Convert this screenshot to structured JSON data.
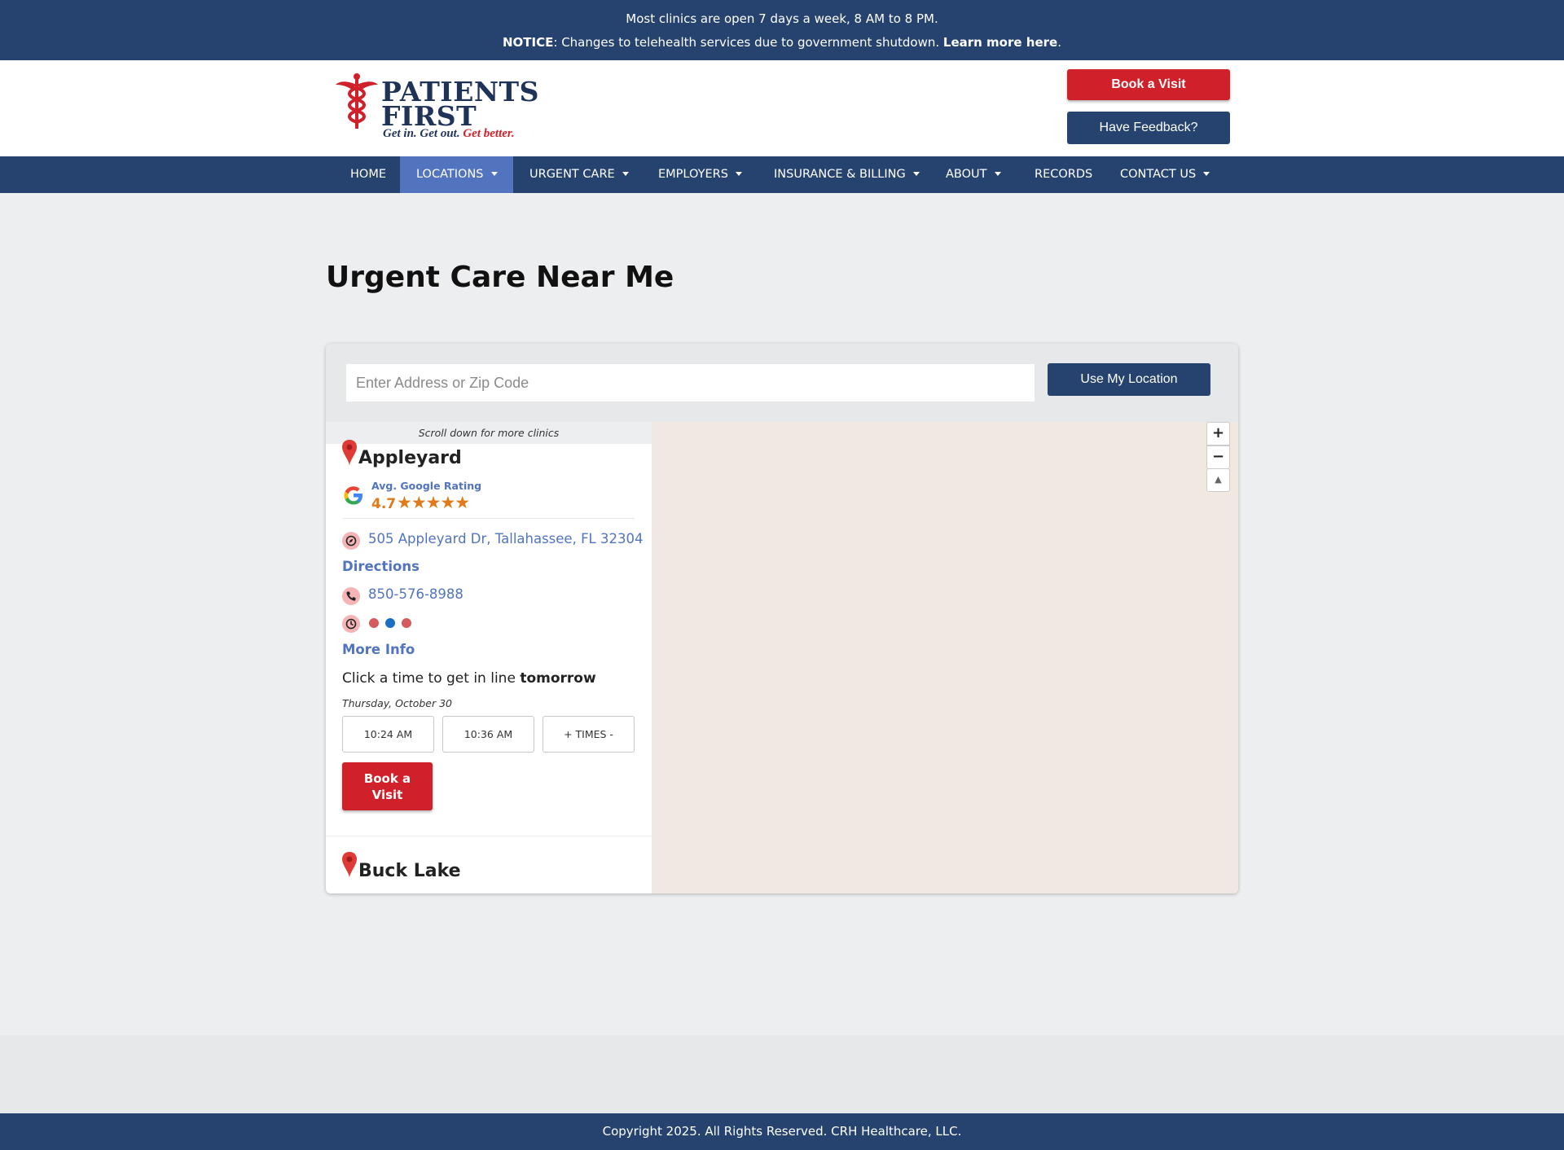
{
  "topbar": {
    "hours": "Most clinics are open 7 days a week, 8 AM to 8 PM.",
    "notice_label": "NOTICE",
    "notice_text": ": Changes to telehealth services due to government shutdown. ",
    "notice_link": "Learn more here",
    "notice_end": "."
  },
  "header": {
    "logo_line1": "PATIENTS",
    "logo_line2": "FIRST",
    "logo_tag_a": "Get in. Get out. ",
    "logo_tag_b": "Get better.",
    "book_label": "Book a Visit",
    "feedback_label": "Have Feedback?"
  },
  "nav": {
    "items": [
      {
        "label": "HOME"
      },
      {
        "label": "LOCATIONS"
      },
      {
        "label": "URGENT CARE"
      },
      {
        "label": "EMPLOYERS"
      },
      {
        "label": "INSURANCE & BILLING"
      },
      {
        "label": "ABOUT"
      },
      {
        "label": "RECORDS"
      },
      {
        "label": "CONTACT US"
      }
    ],
    "active": "LOCATIONS"
  },
  "page": {
    "title": "Urgent Care Near Me"
  },
  "finder": {
    "search_placeholder": "Enter Address or Zip Code",
    "search_value": "",
    "use_location_label": "Use My Location",
    "scroll_hint": "Scroll down for more clinics",
    "clinics": [
      {
        "name": "Appleyard",
        "rating_label": "Avg. Google Rating",
        "rating": "4.7",
        "stars": "★★★★★",
        "address": "505 Appleyard Dr, Tallahassee, FL 32304",
        "directions_label": "Directions",
        "phone": "850-576-8988",
        "more_info_label": "More Info",
        "get_in_line_text": "Click a time to get in line ",
        "get_in_line_day": "tomorrow",
        "date": "Thursday, October 30",
        "times": [
          "10:24 AM",
          "10:36 AM",
          "+ TIMES -"
        ],
        "book_label": "Book a Visit"
      },
      {
        "name": "Buck Lake"
      }
    ]
  },
  "map": {
    "zoom_in": "+",
    "zoom_out": "−",
    "reset": "▲"
  },
  "footer": {
    "copyright": "Copyright 2025. All Rights Reserved. CRH Healthcare, LLC."
  },
  "colors": {
    "brand_navy": "#26436f",
    "brand_red": "#d0202a",
    "link_blue": "#5274bf",
    "rating_orange": "#e07a1a"
  }
}
